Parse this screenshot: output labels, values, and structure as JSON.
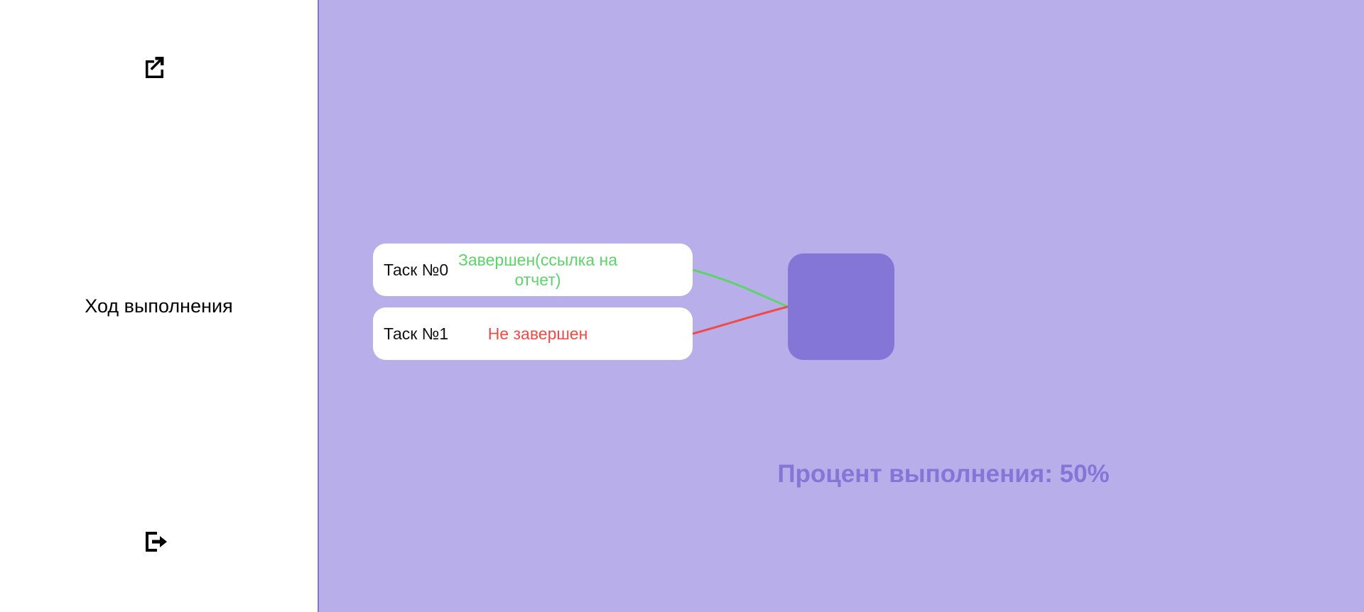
{
  "colors": {
    "background": "#b7aeea",
    "accent": "#8476d7",
    "sidebar": "#ffffff",
    "done": "#5cd46a",
    "not_done": "#ef4b47"
  },
  "sidebar": {
    "top_icon": "open-external-icon",
    "label": "Ход выполнения",
    "bottom_icon": "logout-icon"
  },
  "tasks": [
    {
      "name": "Таск №0",
      "status": "Завершен(ссылка на отчет)",
      "state": "done"
    },
    {
      "name": "Таск №1",
      "status": "Не завершен",
      "state": "not_done"
    }
  ],
  "progress": {
    "label": "Процент выполнения: 50%",
    "percent": 50
  }
}
